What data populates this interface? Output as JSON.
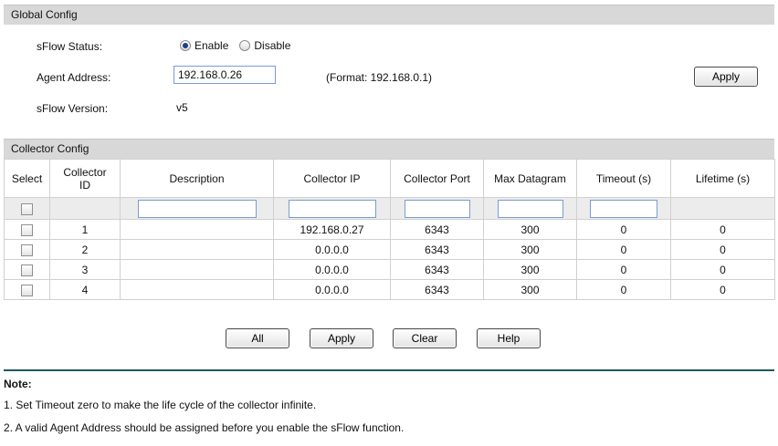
{
  "global_config": {
    "title": "Global Config",
    "sflow_status_label": "sFlow Status:",
    "enable_label": "Enable",
    "disable_label": "Disable",
    "status_selected": "Enable",
    "agent_address_label": "Agent Address:",
    "agent_address_value": "192.168.0.26",
    "format_hint": "(Format: 192.168.0.1)",
    "apply_label": "Apply",
    "sflow_version_label": "sFlow Version:",
    "sflow_version_value": "v5"
  },
  "collector_config": {
    "title": "Collector Config",
    "columns": [
      "Select",
      "Collector ID",
      "Description",
      "Collector IP",
      "Collector Port",
      "Max Datagram",
      "Timeout (s)",
      "Lifetime (s)"
    ],
    "rows": [
      {
        "id": "1",
        "description": "",
        "ip": "192.168.0.27",
        "port": "6343",
        "max_datagram": "300",
        "timeout": "0",
        "lifetime": "0"
      },
      {
        "id": "2",
        "description": "",
        "ip": "0.0.0.0",
        "port": "6343",
        "max_datagram": "300",
        "timeout": "0",
        "lifetime": "0"
      },
      {
        "id": "3",
        "description": "",
        "ip": "0.0.0.0",
        "port": "6343",
        "max_datagram": "300",
        "timeout": "0",
        "lifetime": "0"
      },
      {
        "id": "4",
        "description": "",
        "ip": "0.0.0.0",
        "port": "6343",
        "max_datagram": "300",
        "timeout": "0",
        "lifetime": "0"
      }
    ]
  },
  "buttons": {
    "all": "All",
    "apply": "Apply",
    "clear": "Clear",
    "help": "Help"
  },
  "note": {
    "title": "Note:",
    "lines": [
      "1. Set Timeout zero to make the life cycle of the collector infinite.",
      "2. A valid Agent Address should be assigned before you enable the sFlow function."
    ]
  }
}
